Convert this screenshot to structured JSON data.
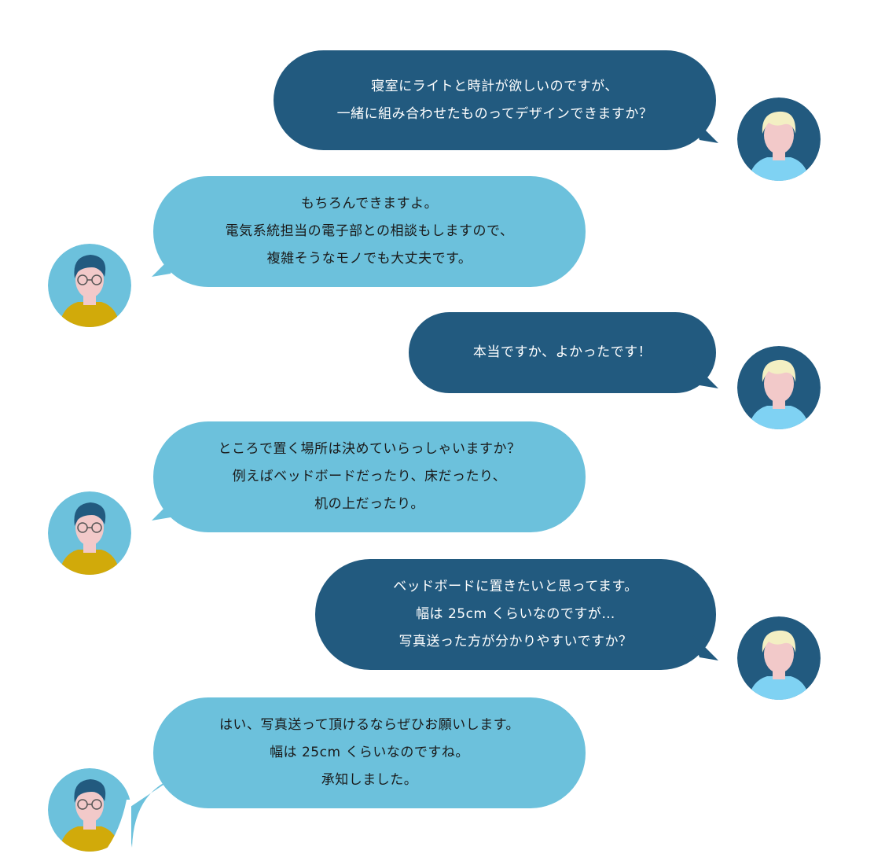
{
  "messages": [
    {
      "side": "right",
      "lines": [
        "寝室にライトと時計が欲しいのですが、",
        "一緒に組み合わせたものってデザインできますか？"
      ]
    },
    {
      "side": "left",
      "lines": [
        "もちろんできますよ。",
        "電気系統担当の電子部との相談もしますので、",
        "複雑そうなモノでも大丈夫です。"
      ]
    },
    {
      "side": "right",
      "lines": [
        "本当ですか、よかったです！"
      ]
    },
    {
      "side": "left",
      "lines": [
        "ところで置く場所は決めていらっしゃいますか？",
        "例えばベッドボードだったり、床だったり、",
        "机の上だったり。"
      ]
    },
    {
      "side": "right",
      "lines": [
        "ベッドボードに置きたいと思ってます。",
        "幅は 25cm くらいなのですが…",
        "写真送った方が分かりやすいですか？"
      ]
    },
    {
      "side": "left",
      "lines": [
        "はい、写真送って頂けるならぜひお願いします。",
        "幅は 25cm くらいなのですね。",
        "承知しました。"
      ]
    }
  ],
  "avatars": {
    "customer": {
      "name_icon": "customer-avatar-icon",
      "bg": "#225a7f",
      "hair": "#f3efc3",
      "skin": "#f2c9c9",
      "shirt": "#7fd2f3"
    },
    "designer": {
      "name_icon": "designer-avatar-icon",
      "bg": "#6cc1dc",
      "hair": "#225a7f",
      "skin": "#f2c9c9",
      "shirt": "#d1aa0a"
    }
  },
  "colors": {
    "right_bubble": "#225a7f",
    "left_bubble": "#6cc1dc"
  }
}
